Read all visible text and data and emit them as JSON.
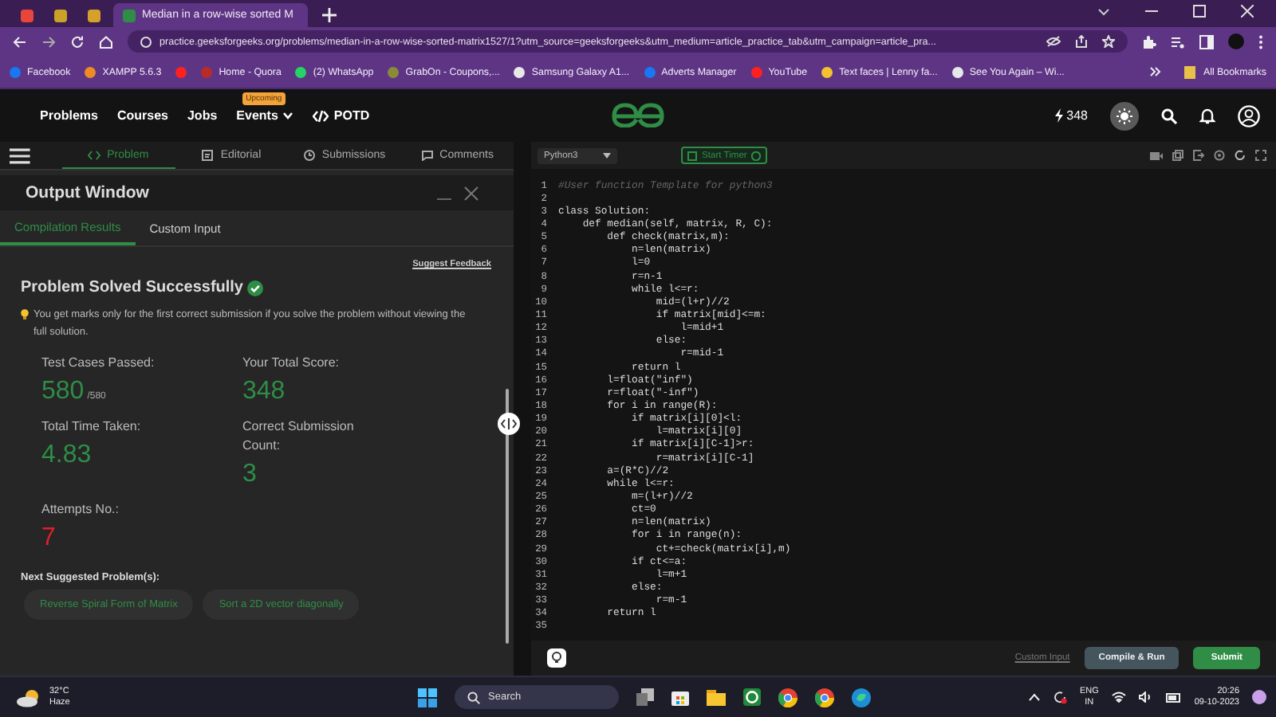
{
  "browser": {
    "tabs": [
      {
        "color": "#e8453c",
        "selected": false
      },
      {
        "color": "#c9a227",
        "selected": false
      },
      {
        "color": "#d4a12a",
        "selected": false
      },
      {
        "title": "Median in a row-wise sorted M",
        "color": "#2f8d46",
        "selected": true
      }
    ],
    "address": "practice.geeksforgeeks.org/problems/median-in-a-row-wise-sorted-matrix1527/1?utm_source=geeksforgeeks&utm_medium=article_practice_tab&utm_campaign=article_pra...",
    "bookmarks": [
      {
        "label": "Facebook",
        "color": "#1877f2"
      },
      {
        "label": "XAMPP 5.6.3",
        "color": "#f08a24"
      },
      {
        "color": "#ff2020"
      },
      {
        "label": "Home - Quora",
        "color": "#b92b27"
      },
      {
        "label": "(2) WhatsApp",
        "color": "#25d366"
      },
      {
        "label": "GrabOn - Coupons,...",
        "color": "#8a8a3a"
      },
      {
        "label": "Samsung Galaxy A1...",
        "color": "#e8e8e8"
      },
      {
        "label": "Adverts Manager",
        "color": "#1877f2"
      },
      {
        "label": "YouTube",
        "color": "#ff2020"
      },
      {
        "label": "Text faces | Lenny fa...",
        "color": "#f2c230"
      },
      {
        "label": "See You Again – Wi...",
        "color": "#e8e8e8"
      }
    ],
    "all_bookmarks": "All Bookmarks"
  },
  "nav": {
    "items": [
      {
        "label": "Problems"
      },
      {
        "label": "Courses"
      },
      {
        "label": "Jobs"
      },
      {
        "label": "Events",
        "badge": "Upcoming"
      },
      {
        "label": "POTD"
      }
    ],
    "streak": "348"
  },
  "left": {
    "tabs": [
      {
        "label": "Problem",
        "selected": true
      },
      {
        "label": "Editorial",
        "selected": false
      },
      {
        "label": "Submissions",
        "selected": false
      },
      {
        "label": "Comments",
        "selected": false
      }
    ],
    "output_title": "Output Window",
    "result_tabs": [
      {
        "label": "Compilation Results",
        "selected": true
      },
      {
        "label": "Custom Input",
        "selected": false
      }
    ],
    "suggest": "Suggest Feedback",
    "heading": "Problem Solved Successfully",
    "note": "You get marks only for the first correct submission if you solve the problem without viewing the full solution.",
    "stats": [
      {
        "label": "Test Cases Passed:",
        "value": "580",
        "total": "/580",
        "color": "#2f8d46"
      },
      {
        "label": "Your Total Score:",
        "value": "348",
        "color": "#2f8d46"
      },
      {
        "label": "Total Time Taken:",
        "value": "4.83",
        "color": "#2f8d46"
      },
      {
        "label": "Correct Submission Count:",
        "value": "3",
        "color": "#2f8d46"
      },
      {
        "label": "Attempts No.:",
        "value": "7",
        "color": "#e0202a"
      }
    ],
    "next_label": "Next Suggested Problem(s):",
    "suggestions": [
      "Reverse Spiral Form of Matrix",
      "Sort a 2D vector diagonally"
    ]
  },
  "editor": {
    "language": "Python3",
    "timer": "Start Timer",
    "lines": [
      {
        "number": "1",
        "text": "#User function Template for python3",
        "kind": "comment"
      },
      {
        "number": "2",
        "kind": "code"
      },
      {
        "number": "3",
        "text": "class Solution:",
        "kind": "code"
      },
      {
        "number": "4",
        "text": "    def median(self, matrix, R, C):",
        "kind": "code"
      },
      {
        "number": "5",
        "text": "        def check(matrix,m):",
        "kind": "code"
      },
      {
        "number": "6",
        "text": "            n=len(matrix)",
        "kind": "code"
      },
      {
        "number": "7",
        "text": "            l=0",
        "kind": "code"
      },
      {
        "number": "8",
        "text": "            r=n-1",
        "kind": "code"
      },
      {
        "number": "9",
        "text": "            while l<=r:",
        "kind": "code"
      },
      {
        "number": "10",
        "text": "                mid=(l+r)//2",
        "kind": "code"
      },
      {
        "number": "11",
        "text": "                if matrix[mid]<=m:",
        "kind": "code"
      },
      {
        "number": "12",
        "text": "                    l=mid+1",
        "kind": "code"
      },
      {
        "number": "13",
        "text": "                else:",
        "kind": "code"
      },
      {
        "number": "14",
        "text": "                    r=mid-1",
        "kind": "code"
      },
      {
        "number": "15",
        "text": "            return l",
        "kind": "code"
      },
      {
        "number": "16",
        "text": "        l=float(\"inf\")",
        "kind": "code"
      },
      {
        "number": "17",
        "text": "        r=float(\"-inf\")",
        "kind": "code"
      },
      {
        "number": "18",
        "text": "        for i in range(R):",
        "kind": "code"
      },
      {
        "number": "19",
        "text": "            if matrix[i][0]<l:",
        "kind": "code"
      },
      {
        "number": "20",
        "text": "                l=matrix[i][0]",
        "kind": "code"
      },
      {
        "number": "21",
        "text": "            if matrix[i][C-1]>r:",
        "kind": "code"
      },
      {
        "number": "22",
        "text": "                r=matrix[i][C-1]",
        "kind": "code"
      },
      {
        "number": "23",
        "text": "        a=(R*C)//2",
        "kind": "code"
      },
      {
        "number": "24",
        "text": "        while l<=r:",
        "kind": "code"
      },
      {
        "number": "25",
        "text": "            m=(l+r)//2",
        "kind": "code"
      },
      {
        "number": "26",
        "text": "            ct=0",
        "kind": "code"
      },
      {
        "number": "27",
        "text": "            n=len(matrix)",
        "kind": "code"
      },
      {
        "number": "28",
        "text": "            for i in range(n):",
        "kind": "code"
      },
      {
        "number": "29",
        "text": "                ct+=check(matrix[i],m)",
        "kind": "code"
      },
      {
        "number": "30",
        "text": "            if ct<=a:",
        "kind": "code"
      },
      {
        "number": "31",
        "text": "                l=m+1",
        "kind": "code"
      },
      {
        "number": "32",
        "text": "            else:",
        "kind": "code"
      },
      {
        "number": "33",
        "text": "                r=m-1",
        "kind": "code"
      },
      {
        "number": "34",
        "text": "        return l",
        "kind": "code"
      },
      {
        "number": "35",
        "kind": "code"
      }
    ],
    "custom_input": "Custom Input",
    "compile": "Compile & Run",
    "submit": "Submit"
  },
  "taskbar": {
    "temperature": "32°C",
    "weather": "Haze",
    "search": "Search",
    "lang": "ENG",
    "region": "IN",
    "time": "20:26",
    "date": "09-10-2023"
  }
}
